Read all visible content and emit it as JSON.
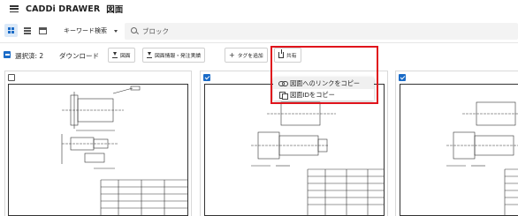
{
  "header": {
    "app_title": "CADDi DRAWER",
    "page_title": "図面"
  },
  "toolbar": {
    "keyword_select": "キーワード検索",
    "search_placeholder": "ブロック"
  },
  "selection_bar": {
    "selected_label": "選択済: 2",
    "download_label": "ダウンロード",
    "buttons": {
      "drawing": "図面",
      "drawing_info": "図面情報・発注実績",
      "add_tag": "タグを追加",
      "share": "共有"
    }
  },
  "share_menu": {
    "items": [
      {
        "label": "図面へのリンクをコピー",
        "icon": "link-icon"
      },
      {
        "label": "図面IDをコピー",
        "icon": "copy-icon"
      }
    ]
  },
  "cards": [
    {
      "checked": false
    },
    {
      "checked": true
    },
    {
      "checked": true
    }
  ],
  "colors": {
    "accent": "#1a6bc7",
    "highlight": "#e0141c"
  }
}
